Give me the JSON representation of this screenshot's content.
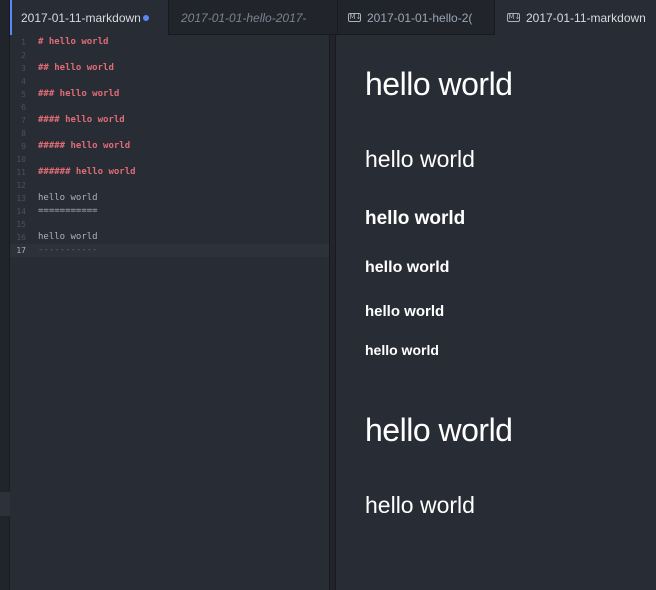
{
  "tabs": [
    {
      "label": "2017-01-11-markdown",
      "modified": true,
      "icon": "",
      "active": true
    },
    {
      "label": "2017-01-01-hello-2017-",
      "italic": true,
      "icon": ""
    },
    {
      "label": "2017-01-01-hello-2(",
      "icon": "markdown-preview-icon"
    },
    {
      "label": "2017-01-11-markdown",
      "icon": "markdown-preview-icon",
      "active": true
    }
  ],
  "editor": {
    "lines": [
      {
        "n": "1",
        "text": "# hello world",
        "kind": "heading"
      },
      {
        "n": "2",
        "text": "",
        "kind": "plain"
      },
      {
        "n": "3",
        "text": "## hello world",
        "kind": "heading"
      },
      {
        "n": "4",
        "text": "",
        "kind": "plain"
      },
      {
        "n": "5",
        "text": "### hello world",
        "kind": "heading"
      },
      {
        "n": "6",
        "text": "",
        "kind": "plain"
      },
      {
        "n": "7",
        "text": "#### hello world",
        "kind": "heading"
      },
      {
        "n": "8",
        "text": "",
        "kind": "plain"
      },
      {
        "n": "9",
        "text": "##### hello world",
        "kind": "heading"
      },
      {
        "n": "10",
        "text": "",
        "kind": "plain"
      },
      {
        "n": "11",
        "text": "###### hello world",
        "kind": "heading"
      },
      {
        "n": "12",
        "text": "",
        "kind": "plain"
      },
      {
        "n": "13",
        "text": "hello world",
        "kind": "plain"
      },
      {
        "n": "14",
        "text": "===========",
        "kind": "plain"
      },
      {
        "n": "15",
        "text": "",
        "kind": "plain"
      },
      {
        "n": "16",
        "text": "hello world",
        "kind": "plain"
      },
      {
        "n": "17",
        "text": "-----------",
        "kind": "dim",
        "current": true
      }
    ]
  },
  "preview": {
    "headings": [
      {
        "level": "h1",
        "text": "hello world"
      },
      {
        "level": "h2",
        "text": "hello world"
      },
      {
        "level": "h3",
        "text": "hello world"
      },
      {
        "level": "h4",
        "text": "hello world"
      },
      {
        "level": "h5",
        "text": "hello world"
      },
      {
        "level": "h6",
        "text": "hello world"
      },
      {
        "level": "h1",
        "text": "hello world"
      },
      {
        "level": "h2",
        "text": "hello world"
      }
    ]
  },
  "colors": {
    "accent": "#568af2",
    "heading_syntax": "#e06c75",
    "background": "#282c34"
  }
}
